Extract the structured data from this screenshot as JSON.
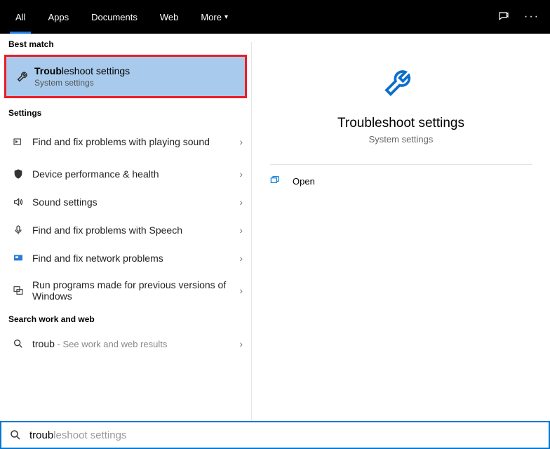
{
  "tabs": {
    "all": "All",
    "apps": "Apps",
    "documents": "Documents",
    "web": "Web",
    "more": "More"
  },
  "sections": {
    "best_match": "Best match",
    "settings": "Settings",
    "search_web": "Search work and web"
  },
  "best_match": {
    "title_bold": "Troub",
    "title_rest": "leshoot settings",
    "subtitle": "System settings"
  },
  "settings_items": [
    {
      "label": "Find and fix problems with playing sound"
    },
    {
      "label": "Device performance & health"
    },
    {
      "label": "Sound settings"
    },
    {
      "label": "Find and fix problems with Speech"
    },
    {
      "label": "Find and fix network problems"
    },
    {
      "label": "Run programs made for previous versions of Windows"
    }
  ],
  "web_item": {
    "prefix": "troub",
    "suffix": " - See work and web results"
  },
  "preview": {
    "title": "Troubleshoot settings",
    "subtitle": "System settings",
    "open": "Open"
  },
  "search": {
    "typed": "troub",
    "ghost": "leshoot settings"
  }
}
